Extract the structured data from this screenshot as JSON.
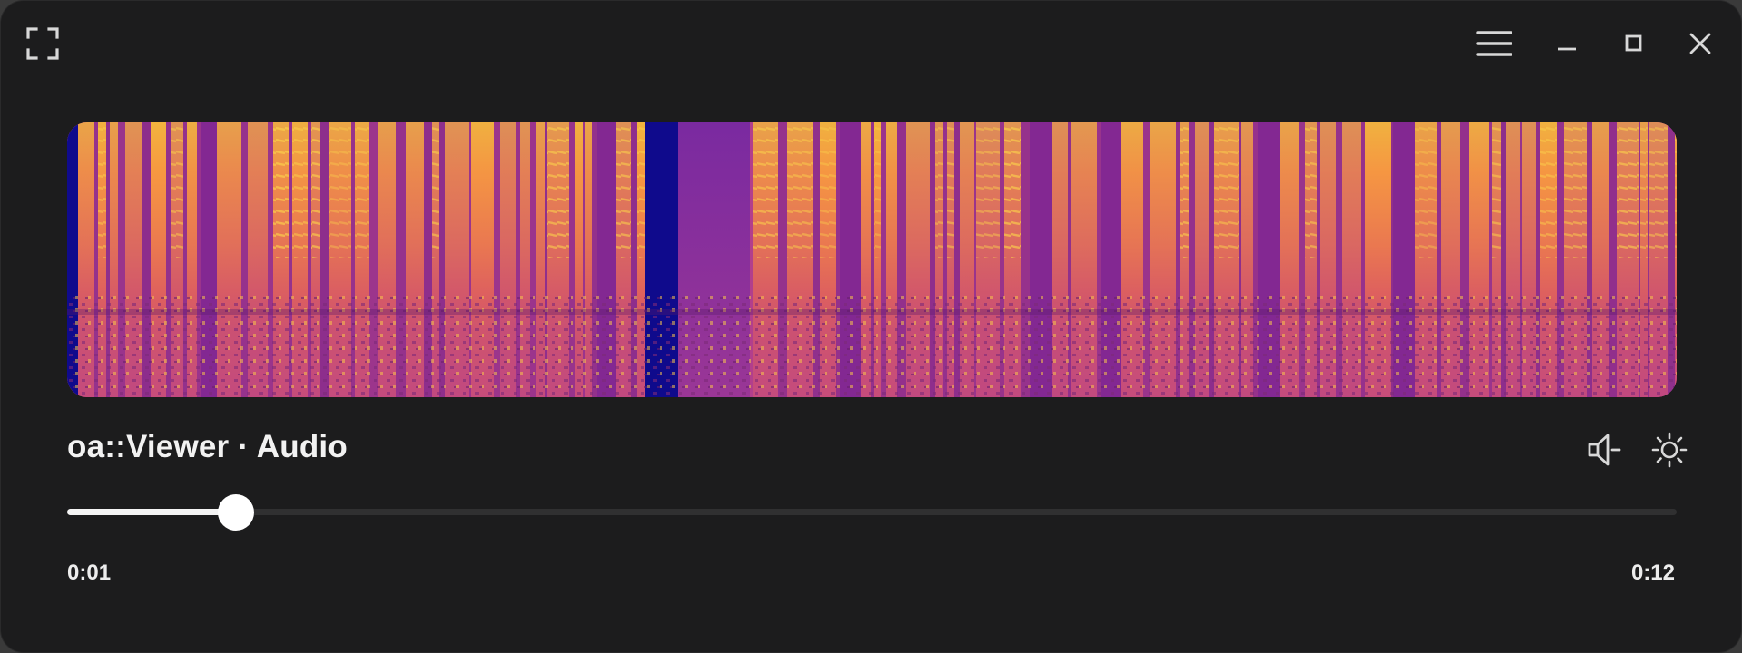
{
  "window": {
    "title": "oa::Viewer · Audio",
    "controls": {
      "fullscreen_icon": "fullscreen-icon",
      "menu_icon": "hamburger-menu-icon",
      "minimize_icon": "minimize-icon",
      "maximize_icon": "maximize-icon",
      "close_icon": "close-icon"
    }
  },
  "media": {
    "visualization": "spectrogram",
    "transport": {
      "prev_icon": "seek-back-icon",
      "play_icon": "play-icon",
      "next_icon": "seek-forward-icon"
    },
    "actions": {
      "volume_icon": "speaker-volume-icon",
      "theme_icon": "sun-brightness-icon"
    },
    "playback": {
      "current_time": "0:01",
      "total_time": "0:12",
      "progress_fraction": 0.105
    }
  },
  "colors": {
    "background": "#1c1c1d",
    "spectrogram_low": "#0d0887",
    "spectrogram_mid": "#cc4778",
    "spectrogram_high": "#f0f921",
    "seek_fill": "#f4f4f4",
    "seek_track": "#303031"
  }
}
